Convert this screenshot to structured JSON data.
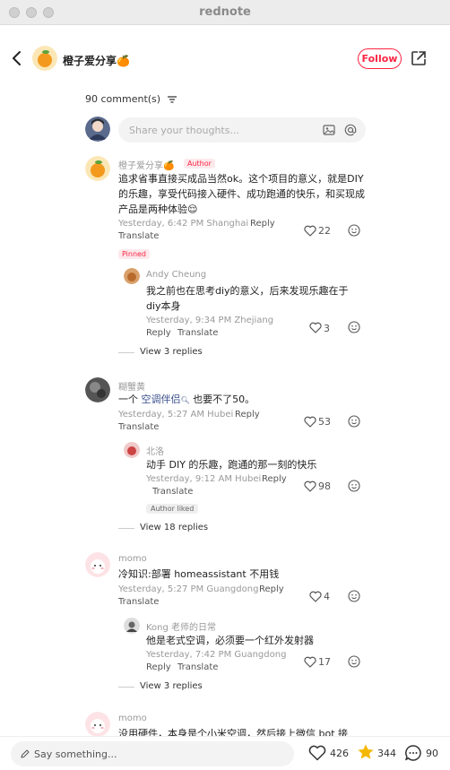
{
  "window": {
    "title": "rednote"
  },
  "header": {
    "author_name": "橙子爱分享🍊",
    "follow_label": "Follow"
  },
  "comments_count": "90 comment(s)",
  "share_placeholder": "Share your thoughts...",
  "comments": [
    {
      "user": "橙子爱分享🍊",
      "tag": "Author",
      "text": "追求省事直接买成品当然ok。这个项目的意义，就是DIY的乐趣，享受代码接入硬件、成功跑通的快乐，和买现成产品是两种体验😌",
      "meta": "Yesterday, 6:42 PM Shanghai",
      "reply": "Reply",
      "translate": "Translate",
      "likes": "22",
      "pinned": "Pinned",
      "sub": {
        "user": "Andy Cheung",
        "text": "我之前也在思考diy的意义，后来发现乐趣在于diy本身",
        "meta": "Yesterday, 9:34 PM Zhejiang",
        "reply": "Reply",
        "translate": "Translate",
        "likes": "3"
      },
      "view_replies": "View 3 replies"
    },
    {
      "user": "糊蟹黄",
      "text_pre": "一个 ",
      "text_link": "空调伴侣",
      "text_post": " 也要不了50。",
      "meta": "Yesterday, 5:27 AM Hubei",
      "reply": "Reply",
      "translate": "Translate",
      "likes": "53",
      "sub": {
        "user": "北洛",
        "text": "动手 DIY 的乐趣，跑通的那一刻的快乐",
        "meta": "Yesterday, 9:12 AM Hubei",
        "reply": "Reply",
        "translate": "Translate",
        "likes": "98",
        "tag": "Author liked"
      },
      "view_replies": "View 18 replies"
    },
    {
      "user": "momo",
      "text": "冷知识:部署 homeassistant 不用钱",
      "meta": "Yesterday, 5:27 PM Guangdong",
      "reply": "Reply",
      "translate": "Translate",
      "likes": "4",
      "sub": {
        "user": "Kong 老师的日常",
        "text": "他是老式空调，必须要一个红外发射器",
        "meta": "Yesterday, 7:42 PM Guangdong",
        "reply": "Reply",
        "translate": "Translate",
        "likes": "17"
      },
      "view_replies": "View 3 replies"
    },
    {
      "user": "momo",
      "text": "没用硬件，本身是个小米空调，然后接上微信 bot 接"
    }
  ],
  "bottom": {
    "say_placeholder": "Say something...",
    "likes": "426",
    "stars": "344",
    "comments": "90"
  },
  "colors": {
    "brand": "#ff2442",
    "star": "#f5b800",
    "link": "#3a4f8c"
  }
}
